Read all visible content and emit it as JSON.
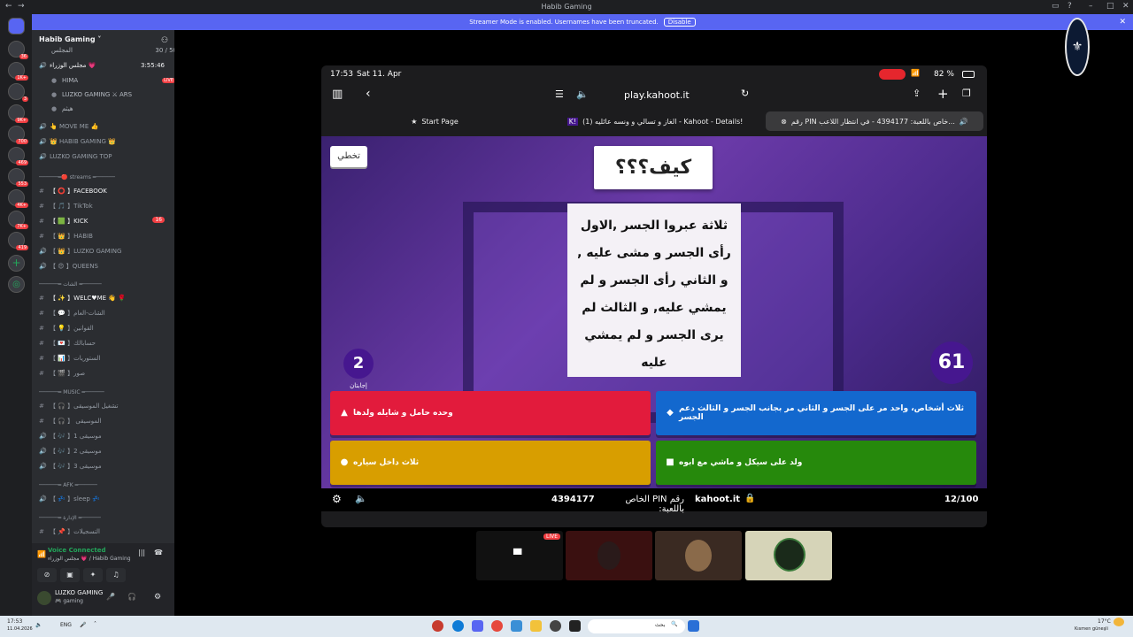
{
  "app": {
    "title": "Habib Gaming"
  },
  "banner": {
    "text": "Streamer Mode is enabled. Usernames have been truncated.",
    "disable": "Disable"
  },
  "rail_badges": [
    "36",
    "1K+",
    "3",
    "9K+",
    "700",
    "469",
    "553",
    "4K+",
    "7K+",
    "419"
  ],
  "server": {
    "name": "Habib Gaming"
  },
  "channels": {
    "top1": "المجلس",
    "top1_count": "30 / 50",
    "top2": "مجلس الوزراء 💗",
    "top2_time": "3:55:46",
    "user1": "HIMA",
    "user1_live": "LIVE",
    "user2": "LUZKO GAMING ⚔ ARS",
    "user3": "هيثم",
    "move": "👆 MOVE ME 👍",
    "habib": "👑 HABIB GAMING 👑",
    "luzko_top": "LUZKO GAMING TOP",
    "cat_streams": "──────═🔴 streams ═──────",
    "facebook": "【 ⭕ 】FACEBOOK",
    "tiktok": "【 🎵 】TikTok",
    "kick": "【 🟩 】KICK",
    "kick_count": "16",
    "habib_ch": "【 👑 】HABIB",
    "luzko_ch": "【 👑 】LUZKO GAMING",
    "queens": "【 😍 】QUEENS",
    "cat_chat": "──────═ الشات ═──────",
    "welcome": "【 ✨ 】WELC♥ME 👋 🌹",
    "chat1": "【 💬 】الشات-العام",
    "chat2": "【 💡 】القوانين",
    "chat3": "【 💌 】حسابالك",
    "chat4": "【 📊 】الستوريات",
    "chat5": "【 🎬 】صور",
    "cat_music": "──────═ MUSIC ═──────",
    "music1": "【 🎧 】تشغيل الموسيقى",
    "music2": "【 🎧 】 الموسيقى",
    "music3": "【 🎶 】موسيقى 1",
    "music4": "【 🎶 】موسيقى 2",
    "music5": "【 🎶 】موسيقى 3",
    "cat_afk": "──────═ AFK ═──────",
    "afk": "【 💤 】sleep 💤",
    "cat_admin": "──────═ الإدارة ═──────",
    "admin1": "【 📌 】التسجيلات"
  },
  "voice": {
    "status": "Voice Connected",
    "channel": "مجلس الوزراء 💗 / Habib Gaming"
  },
  "user": {
    "name": "LUZKO GAMING",
    "status": "🎮 gaming"
  },
  "ipad": {
    "time": "17:53",
    "date": "Sat 11. Apr",
    "battery": "82 %",
    "url": "play.kahoot.it",
    "tabs": [
      "Start Page",
      "الغاز و تسالي و ونسه عائليه (1) - Kahoot - Details!",
      "رقم PIN خاص باللعبة: 4394177 - في انتظار اللاعب..."
    ]
  },
  "kahoot": {
    "skip": "تخطي",
    "title": "كيف؟؟؟",
    "question": "ثلاثة عبروا الجسر ,الاول رأى الجسر و مشى عليه , و الثاني رأى الجسر و لم يمشي عليه, و الثالث لم يرى الجسر و لم يمشي عليه",
    "answers_count": "2",
    "answers_label": "إجابتان",
    "timer": "61",
    "answers": [
      {
        "text": "وحده حامل و شايله ولدها",
        "color": "#e21b3c",
        "shape": "▲"
      },
      {
        "text": "ثلاث أشخاص، واحد مر على الجسر و الثاني مر بجانب الجسر و الثالث دعم الجسر",
        "color": "#1368ce",
        "shape": "◆"
      },
      {
        "text": "ثلاث داخل سياره",
        "color": "#d89e00",
        "shape": "●"
      },
      {
        "text": "ولد على سيكل و ماشي مع ابوه",
        "color": "#26890c",
        "shape": "■"
      }
    ],
    "footer": {
      "pin_label": "رقم PIN الخاص باللعبة:",
      "pin": "4394177",
      "brand": "kahoot.it",
      "progress": "12/100"
    }
  },
  "streams": {
    "live": "LIVE"
  },
  "taskbar": {
    "date": "11.04.2026",
    "time": "17:53",
    "lang": "ENG",
    "search": "بحث",
    "weather": "17°C",
    "weather_desc": "Kısmen güneşli"
  }
}
